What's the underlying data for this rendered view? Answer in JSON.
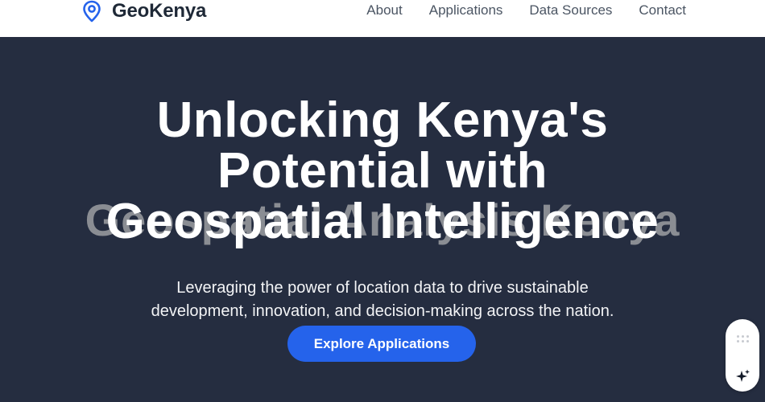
{
  "navbar": {
    "brand": {
      "name": "GeoKenya",
      "icon": "map-pin-icon",
      "accent": "#2563eb"
    },
    "links": [
      "About",
      "Applications",
      "Data Sources",
      "Contact"
    ]
  },
  "hero": {
    "background": "#252d40",
    "title_lines": [
      "Unlocking Kenya's",
      "Potential with",
      "Geospatial Intelligence"
    ],
    "ghost_text": "Geospatial Analysis Kenya",
    "subtitle_lines": [
      "Leveraging the power of location data to drive sustainable",
      "development, innovation, and decision-making across the nation."
    ],
    "cta_label": "Explore Applications",
    "cta_color": "#2563eb"
  },
  "widget": {
    "icons": [
      "drag-handle-icon",
      "sparkle-icon"
    ]
  }
}
